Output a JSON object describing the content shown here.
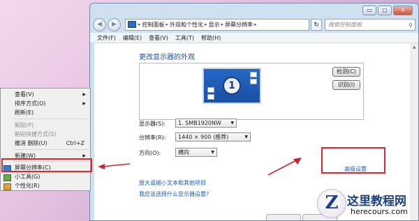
{
  "window": {
    "caption_buttons": {
      "minimize": "▭",
      "maximize": "▢",
      "close": "✕"
    },
    "nav": {
      "back": "◀",
      "forward": "▶"
    },
    "breadcrumb": [
      "控制面板",
      "外观和个性化",
      "显示",
      "屏幕分辨率"
    ],
    "refresh": "↻",
    "search_placeholder": "搜索控制面板",
    "menu": [
      "文件(F)",
      "编辑(E)",
      "查看(V)",
      "工具(T)",
      "帮助(H)"
    ]
  },
  "display_settings": {
    "title": "更改显示器的外观",
    "monitor_number": "1",
    "detect_button": "检测(C)",
    "identify_button": "识别(I)",
    "display_label": "显示器(S):",
    "display_value": "1. SMB1920NW",
    "resolution_label": "分辨率(R):",
    "resolution_value": "1440 × 900 (推荐)",
    "orientation_label": "方向(O):",
    "orientation_value": "横向",
    "advanced_link": "高级设置",
    "link_text_size": "放大或缩小文本和其他项目",
    "link_which_settings": "我应该选择什么显示器设置?"
  },
  "context_menu": {
    "items": [
      {
        "label": "查看(V)",
        "submenu": true
      },
      {
        "label": "排序方式(O)",
        "submenu": true
      },
      {
        "label": "刷新(E)"
      },
      {
        "label": "粘贴(P)",
        "disabled": true
      },
      {
        "label": "粘贴快捷方式(S)",
        "disabled": true
      },
      {
        "label": "撤消 删除(U)",
        "shortcut": "Ctrl+Z"
      },
      {
        "label": "新建(W)",
        "submenu": true
      },
      {
        "label": "屏幕分辨率(C)"
      },
      {
        "label": "小工具(G)"
      },
      {
        "label": "个性化(R)"
      }
    ]
  },
  "watermark": {
    "badge": "Z",
    "title": "这里教程网",
    "subtitle": "herecours.com"
  },
  "colors": {
    "highlight_red": "#e0252c",
    "link_blue": "#1c5cbf",
    "title_blue": "#1d4d94"
  }
}
